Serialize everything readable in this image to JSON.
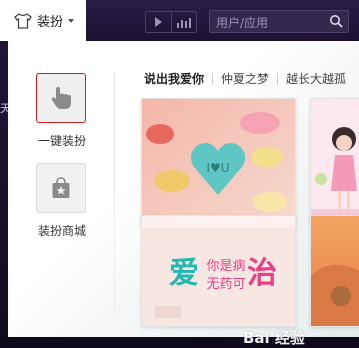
{
  "topbar": {
    "skin_label": "装扮",
    "search_placeholder": "用户/应用"
  },
  "sidebar": {
    "items": [
      {
        "label": "一键装扮",
        "icon": "hand-pointer-icon",
        "selected": true
      },
      {
        "label": "装扮商城",
        "icon": "shopping-bag-star-icon",
        "selected": false
      }
    ]
  },
  "tabs": [
    {
      "label": "说出我爱你",
      "active": true
    },
    {
      "label": "仲夏之梦",
      "active": false
    },
    {
      "label": "越长大越孤",
      "active": false
    }
  ],
  "thumbnails": [
    {
      "name": "candy-heart-iou",
      "text": "I♥U"
    },
    {
      "name": "cartoon-girl",
      "text": ""
    },
    {
      "name": "love-you-sick",
      "text_big": "爱",
      "text_small1": "你是病",
      "text_small2": "无药可",
      "text_big2": "治"
    },
    {
      "name": "orange-scenery",
      "text": ""
    }
  ],
  "watermark": "Bai 经验",
  "colors": {
    "topbar": "#2a1c45",
    "selected_border": "#cc1f1f",
    "panel": "#ffffff"
  }
}
